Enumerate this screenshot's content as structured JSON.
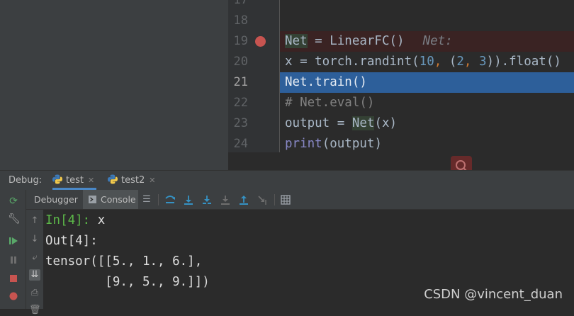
{
  "editor": {
    "lines": [
      {
        "num": "17",
        "text": ""
      },
      {
        "num": "18",
        "text": ""
      },
      {
        "num": "19",
        "breakpoint": true,
        "parts": [
          {
            "t": "Net",
            "c": "hl-var"
          },
          {
            "t": " = LinearFC()",
            "c": ""
          }
        ],
        "inline_hint": "Net:"
      },
      {
        "num": "20",
        "parts": [
          {
            "t": "x = torch.randint(",
            "c": ""
          },
          {
            "t": "10",
            "c": "kw-num"
          },
          {
            "t": ", ",
            "c": "comma"
          },
          {
            "t": "(",
            "c": ""
          },
          {
            "t": "2",
            "c": "kw-num"
          },
          {
            "t": ", ",
            "c": "comma"
          },
          {
            "t": "3",
            "c": "kw-num"
          },
          {
            "t": ")).float()",
            "c": ""
          }
        ]
      },
      {
        "num": "21",
        "selected": true,
        "current": true,
        "parts": [
          {
            "t": "Net.train()",
            "c": ""
          }
        ]
      },
      {
        "num": "22",
        "parts": [
          {
            "t": "# Net.eval()",
            "c": "comment"
          }
        ]
      },
      {
        "num": "23",
        "parts": [
          {
            "t": "output = ",
            "c": ""
          },
          {
            "t": "Net",
            "c": "hl-var"
          },
          {
            "t": "(x)",
            "c": ""
          }
        ]
      },
      {
        "num": "24",
        "parts": [
          {
            "t": "print",
            "c": "builtin"
          },
          {
            "t": "(output)",
            "c": ""
          }
        ]
      }
    ]
  },
  "debug": {
    "label": "Debug:",
    "tabs": [
      {
        "label": "test",
        "active": true
      },
      {
        "label": "test2",
        "active": false
      }
    ]
  },
  "subtoolbar": {
    "debugger_label": "Debugger",
    "console_label": "Console"
  },
  "console": {
    "lines": [
      {
        "prompt": "In[4]: ",
        "text": "x"
      },
      {
        "prompt": "",
        "text": "Out[4]:"
      },
      {
        "prompt": "",
        "text": "tensor([[5., 1., 6.],"
      },
      {
        "prompt": "",
        "text": "        [9., 5., 9.]])"
      }
    ]
  },
  "watermark": "CSDN @vincent_duan",
  "colors": {
    "accent": "#4a88c7",
    "breakpoint": "#c75450",
    "selection": "#2d5f9a",
    "prompt": "#5bb548"
  }
}
